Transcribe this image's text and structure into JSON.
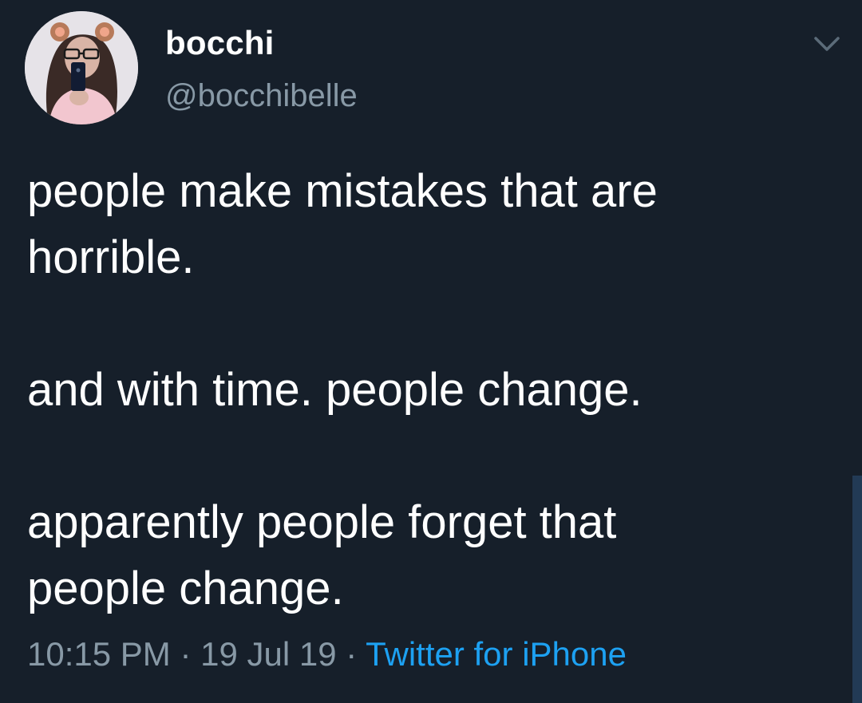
{
  "author": {
    "display_name": "bocchi",
    "handle": "@bocchibelle"
  },
  "tweet": {
    "lines": [
      "people make mistakes that are",
      "horrible.",
      "",
      "and with time. people change.",
      "",
      "apparently people forget that",
      "people change."
    ]
  },
  "meta": {
    "time": "10:15 PM",
    "separator": " · ",
    "date": "19 Jul 19",
    "source": "Twitter for iPhone"
  },
  "icons": {
    "menu": "chevron-down-icon"
  },
  "colors": {
    "background": "#161f2a",
    "text": "#ffffff",
    "secondary_text": "#8899a6",
    "link": "#1da1f2"
  }
}
